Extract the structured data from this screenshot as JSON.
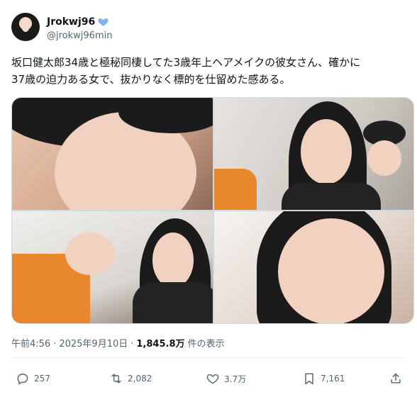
{
  "author": {
    "display_name": "Jrokwj96",
    "handle": "@jrokwj96min",
    "verified_color": "#7fb5f0"
  },
  "tweet": {
    "line1": "坂口健太郎34歳と極秘同棲してた3歳年上ヘアメイクの彼女さん、確かに",
    "line2": "37歳の迫力ある女で、抜かりなく標的を仕留めた感ある。"
  },
  "meta": {
    "time": "午前4:56",
    "sep1": "·",
    "date": "2025年9月10日",
    "sep2": "·",
    "views": "1,845.8万",
    "views_suffix": "件の表示"
  },
  "actions": {
    "reply_count": "257",
    "repost_count": "2,082",
    "like_count": "3.7万",
    "bookmark_count": "7,161"
  },
  "icons": {
    "reply": "reply-icon",
    "repost": "repost-icon",
    "like": "heart-icon",
    "bookmark": "bookmark-icon",
    "share": "share-icon",
    "verified": "verified-badge-icon"
  },
  "colors": {
    "text": "#0f1419",
    "secondary": "#536471",
    "border": "#cfd9de"
  }
}
